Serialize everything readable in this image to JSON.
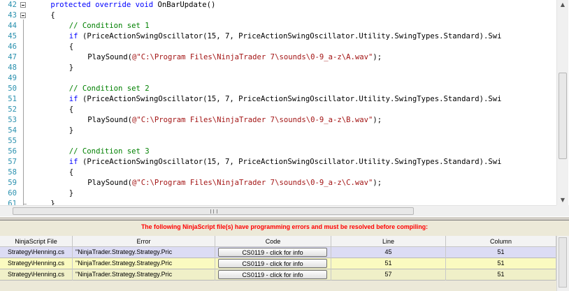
{
  "editor": {
    "lines": [
      {
        "n": "42",
        "indent": 4,
        "tokens": [
          {
            "t": "protected override void ",
            "c": "kw"
          },
          {
            "t": "OnBarUpdate()",
            "c": ""
          }
        ]
      },
      {
        "n": "43",
        "indent": 4,
        "tokens": [
          {
            "t": "{",
            "c": ""
          }
        ]
      },
      {
        "n": "44",
        "indent": 8,
        "tokens": [
          {
            "t": "// Condition set 1",
            "c": "cm"
          }
        ]
      },
      {
        "n": "45",
        "indent": 8,
        "tokens": [
          {
            "t": "if ",
            "c": "kw"
          },
          {
            "t": "(PriceActionSwingOscillator(15, 7, PriceActionSwingOscillator.Utility.SwingTypes.Standard).Swi",
            "c": ""
          }
        ]
      },
      {
        "n": "46",
        "indent": 8,
        "tokens": [
          {
            "t": "{",
            "c": ""
          }
        ]
      },
      {
        "n": "47",
        "indent": 12,
        "tokens": [
          {
            "t": "PlaySound(",
            "c": ""
          },
          {
            "t": "@\"C:\\Program Files\\NinjaTrader 7\\sounds\\0-9_a-z\\A.wav\"",
            "c": "st"
          },
          {
            "t": ");",
            "c": ""
          }
        ]
      },
      {
        "n": "48",
        "indent": 8,
        "tokens": [
          {
            "t": "}",
            "c": ""
          }
        ]
      },
      {
        "n": "49",
        "indent": 0,
        "tokens": []
      },
      {
        "n": "50",
        "indent": 8,
        "tokens": [
          {
            "t": "// Condition set 2",
            "c": "cm"
          }
        ]
      },
      {
        "n": "51",
        "indent": 8,
        "tokens": [
          {
            "t": "if ",
            "c": "kw"
          },
          {
            "t": "(PriceActionSwingOscillator(15, 7, PriceActionSwingOscillator.Utility.SwingTypes.Standard).Swi",
            "c": ""
          }
        ]
      },
      {
        "n": "52",
        "indent": 8,
        "tokens": [
          {
            "t": "{",
            "c": ""
          }
        ]
      },
      {
        "n": "53",
        "indent": 12,
        "tokens": [
          {
            "t": "PlaySound(",
            "c": ""
          },
          {
            "t": "@\"C:\\Program Files\\NinjaTrader 7\\sounds\\0-9_a-z\\B.wav\"",
            "c": "st"
          },
          {
            "t": ");",
            "c": ""
          }
        ]
      },
      {
        "n": "54",
        "indent": 8,
        "tokens": [
          {
            "t": "}",
            "c": ""
          }
        ]
      },
      {
        "n": "55",
        "indent": 0,
        "tokens": []
      },
      {
        "n": "56",
        "indent": 8,
        "tokens": [
          {
            "t": "// Condition set 3",
            "c": "cm"
          }
        ]
      },
      {
        "n": "57",
        "indent": 8,
        "tokens": [
          {
            "t": "if ",
            "c": "kw"
          },
          {
            "t": "(PriceActionSwingOscillator(15, 7, PriceActionSwingOscillator.Utility.SwingTypes.Standard).Swi",
            "c": ""
          }
        ]
      },
      {
        "n": "58",
        "indent": 8,
        "tokens": [
          {
            "t": "{",
            "c": ""
          }
        ]
      },
      {
        "n": "59",
        "indent": 12,
        "tokens": [
          {
            "t": "PlaySound(",
            "c": ""
          },
          {
            "t": "@\"C:\\Program Files\\NinjaTrader 7\\sounds\\0-9_a-z\\C.wav\"",
            "c": "st"
          },
          {
            "t": ");",
            "c": ""
          }
        ]
      },
      {
        "n": "60",
        "indent": 8,
        "tokens": [
          {
            "t": "}",
            "c": ""
          }
        ]
      },
      {
        "n": "61",
        "indent": 4,
        "tokens": [
          {
            "t": "}",
            "c": ""
          }
        ]
      }
    ],
    "colors": {
      "keyword": "#0000ff",
      "comment": "#008000",
      "string": "#a31515",
      "line_number": "#2b91af"
    }
  },
  "errors": {
    "message": "The following NinjaScript file(s) have programming errors and must be resolved before compiling:",
    "columns": [
      "NinjaScript File",
      "Error",
      "Code",
      "Line",
      "Column"
    ],
    "rows": [
      {
        "file": "Strategy\\Henning.cs",
        "error": "\"NinjaTrader.Strategy.Strategy.Pric",
        "code": "CS0119 - click for info",
        "line": "45",
        "column": "51",
        "bg": "#dcdcf4"
      },
      {
        "file": "Strategy\\Henning.cs",
        "error": "\"NinjaTrader.Strategy.Strategy.Pric",
        "code": "CS0119 - click for info",
        "line": "51",
        "column": "51",
        "bg": "#fafac0"
      },
      {
        "file": "Strategy\\Henning.cs",
        "error": "\"NinjaTrader.Strategy.Strategy.Pric",
        "code": "CS0119 - click for info",
        "line": "57",
        "column": "51",
        "bg": "#f0f0c8"
      }
    ],
    "colors": {
      "message": "#ff0000"
    }
  }
}
